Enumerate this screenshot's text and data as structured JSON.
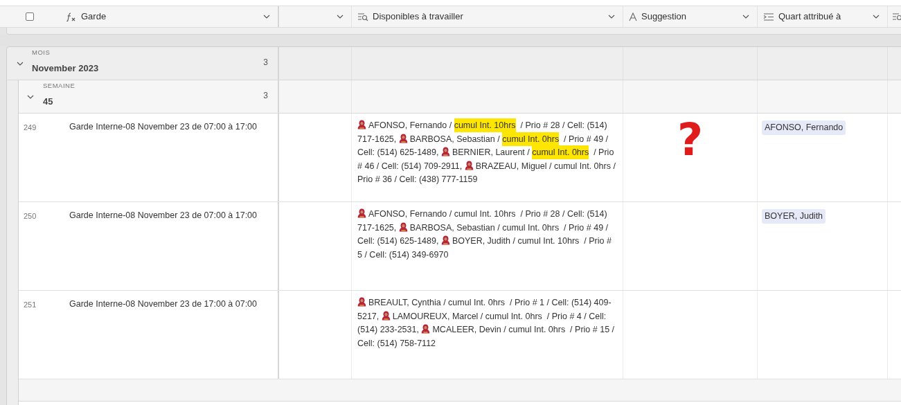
{
  "select_all": {
    "checked": false
  },
  "columns": [
    {
      "kind": "formula",
      "label": "Garde"
    },
    {
      "kind": "blank"
    },
    {
      "kind": "lookup",
      "label": "Disponibles à travailler"
    },
    {
      "kind": "text",
      "label": "Suggestion"
    },
    {
      "kind": "link",
      "label": "Quart attribué à"
    },
    {
      "kind": "cut"
    }
  ],
  "month_group": {
    "label": "MOIS",
    "value": "November 2023",
    "count": "3",
    "expanded": true
  },
  "week_group": {
    "label": "SEMAINE",
    "value": "45",
    "count": "3",
    "expanded": true
  },
  "rows": [
    {
      "number": "249",
      "garde": "Garde Interne-08 November 23 de 07:00 à 17:00",
      "annotation": "?",
      "assigned": "AFONSO, Fernando",
      "candidates": [
        {
          "parts": [
            {
              "text": "AFONSO, Fernando / ",
              "highlighted": false
            },
            {
              "text": "cumul Int. 10hrs",
              "highlighted": true
            },
            {
              "text": "  / Prio # 28 / Cell: (514) 717-1625, ",
              "highlighted": false
            }
          ]
        },
        {
          "parts": [
            {
              "text": "BARBOSA, Sebastian / ",
              "highlighted": false
            },
            {
              "text": "cumul Int. 0hrs",
              "highlighted": true
            },
            {
              "text": "  / Prio # 49 / Cell: (514) 625-1489, ",
              "highlighted": false
            }
          ]
        },
        {
          "parts": [
            {
              "text": "BERNIER, Laurent / ",
              "highlighted": false
            },
            {
              "text": "cumul Int. 0hrs",
              "highlighted": true
            },
            {
              "text": "  / Prio # 46 / Cell: (514) 709-2911, ",
              "highlighted": false
            }
          ]
        },
        {
          "parts": [
            {
              "text": "BRAZEAU, Miguel / cumul Int. 0hrs / Prio # 36 / Cell: (438) 777-1159",
              "highlighted": false
            }
          ]
        }
      ]
    },
    {
      "number": "250",
      "garde": "Garde Interne-08 November 23 de 07:00 à 17:00",
      "assigned": "BOYER, Judith",
      "candidates": [
        {
          "parts": [
            {
              "text": "AFONSO, Fernando / cumul Int. 10hrs  / Prio # 28 / Cell: (514) 717-1625, ",
              "highlighted": false
            }
          ]
        },
        {
          "parts": [
            {
              "text": "BARBOSA, Sebastian / cumul Int. 0hrs  / Prio # 49 / Cell: (514) 625-1489, ",
              "highlighted": false
            }
          ]
        },
        {
          "parts": [
            {
              "text": "BOYER, Judith / cumul Int. 10hrs  / Prio # 5 / Cell: (514) 349-6970",
              "highlighted": false
            }
          ]
        }
      ]
    },
    {
      "number": "251",
      "garde": "Garde Interne-08 November 23 de 17:00 à 07:00",
      "candidates": [
        {
          "parts": [
            {
              "text": "BREAULT, Cynthia / cumul Int. 0hrs  / Prio # 1 / Cell: (514) 409-5217, ",
              "highlighted": false
            }
          ]
        },
        {
          "parts": [
            {
              "text": "LAMOUREUX, Marcel / cumul Int. 0hrs  / Prio # 4 / Cell: (514) 233-2531, ",
              "highlighted": false
            }
          ]
        },
        {
          "parts": [
            {
              "text": "MCALEER, Devin / cumul Int. 0hrs  / Prio # 15 / Cell: (514) 758-7112",
              "highlighted": false
            }
          ]
        }
      ]
    }
  ]
}
